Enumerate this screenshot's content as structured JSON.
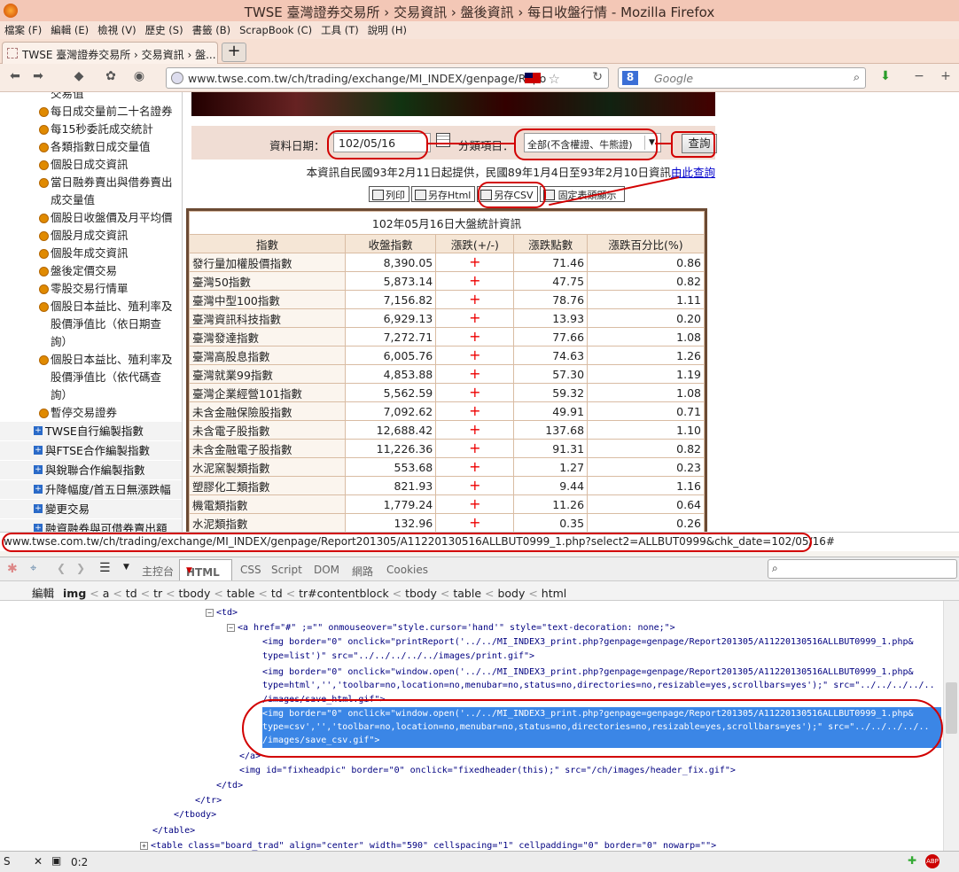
{
  "window": {
    "title": "TWSE 臺灣證券交易所 › 交易資訊 › 盤後資訊 › 每日收盤行情 - Mozilla Firefox"
  },
  "menu": [
    "檔案 (F)",
    "編輯 (E)",
    "檢視 (V)",
    "歷史 (S)",
    "書籤 (B)",
    "ScrapBook (C)",
    "工具 (T)",
    "說明 (H)"
  ],
  "tab": {
    "title": "TWSE 臺灣證券交易所 › 交易資訊 › 盤..."
  },
  "nav": {
    "url": "www.twse.com.tw/ch/trading/exchange/MI_INDEX/genpage/Repo",
    "search_placeholder": "Google",
    "search_engine": "8"
  },
  "sidebar": {
    "sub": [
      "交易值",
      "每日成交量前二十名證券",
      "每15秒委託成交統計",
      "各類指數日成交量值",
      "個股日成交資訊",
      "當日融券賣出與借券賣出",
      "成交量值",
      "個股日收盤價及月平均價",
      "個股月成交資訊",
      "個股年成交資訊",
      "盤後定價交易",
      "零股交易行情單",
      "個股日本益比、殖利率及",
      "股價淨值比（依日期查",
      "詢）",
      "個股日本益比、殖利率及",
      "股價淨值比（依代碼查",
      "詢）",
      "暫停交易證券"
    ],
    "bullets": [
      false,
      true,
      true,
      true,
      true,
      true,
      false,
      true,
      true,
      true,
      true,
      true,
      true,
      false,
      false,
      true,
      false,
      false,
      true
    ],
    "main": [
      "TWSE自行編製指數",
      "與FTSE合作編製指數",
      "與銳聯合作編製指數",
      "升降幅度/首五日無漲跌幅",
      "變更交易",
      "融資融券與可借券賣出額"
    ]
  },
  "query": {
    "date_label": "資料日期：",
    "date_value": "102/05/16",
    "category_label": "分類項目：",
    "category_value": "全部(不含權證、牛熊證)",
    "submit": "查詢",
    "note": "本資訊自民國93年2月11日起提供，民國89年1月4日至93年2月10日資訊",
    "note_link": "由此查詢"
  },
  "toolbar": {
    "print": "列印",
    "save_html": "另存Html",
    "save_csv": "另存CSV",
    "fixed_header": "固定表頭顯示"
  },
  "table": {
    "caption": "102年05月16日大盤統計資訊",
    "headers": [
      "指數",
      "收盤指數",
      "漲跌(+/-)",
      "漲跌點數",
      "漲跌百分比(%)"
    ],
    "rows": [
      [
        "發行量加權股價指數",
        "8,390.05",
        "+",
        "71.46",
        "0.86"
      ],
      [
        "臺灣50指數",
        "5,873.14",
        "+",
        "47.75",
        "0.82"
      ],
      [
        "臺灣中型100指數",
        "7,156.82",
        "+",
        "78.76",
        "1.11"
      ],
      [
        "臺灣資訊科技指數",
        "6,929.13",
        "+",
        "13.93",
        "0.20"
      ],
      [
        "臺灣發達指數",
        "7,272.71",
        "+",
        "77.66",
        "1.08"
      ],
      [
        "臺灣高股息指數",
        "6,005.76",
        "+",
        "74.63",
        "1.26"
      ],
      [
        "臺灣就業99指數",
        "4,853.88",
        "+",
        "57.30",
        "1.19"
      ],
      [
        "臺灣企業經營101指數",
        "5,562.59",
        "+",
        "59.32",
        "1.08"
      ],
      [
        "未含金融保險股指數",
        "7,092.62",
        "+",
        "49.91",
        "0.71"
      ],
      [
        "未含電子股指數",
        "12,688.42",
        "+",
        "137.68",
        "1.10"
      ],
      [
        "未含金融電子股指數",
        "11,226.36",
        "+",
        "91.31",
        "0.82"
      ],
      [
        "水泥窯製類指數",
        "553.68",
        "+",
        "1.27",
        "0.23"
      ],
      [
        "塑膠化工類指數",
        "821.93",
        "+",
        "9.44",
        "1.16"
      ],
      [
        "機電類指數",
        "1,779.24",
        "+",
        "11.26",
        "0.64"
      ],
      [
        "水泥類指數",
        "132.96",
        "+",
        "0.35",
        "0.26"
      ]
    ]
  },
  "status_url": "www.twse.com.tw/ch/trading/exchange/MI_INDEX/genpage/Report201305/A11220130516ALLBUT0999_1.php?select2=ALLBUT0999&chk_date=102/05/16#",
  "firebug": {
    "tabs": [
      "主控台",
      "HTML",
      "CSS",
      "Script",
      "DOM",
      "網路",
      "Cookies"
    ],
    "edit": "編輯",
    "crumbs": [
      "img",
      "a",
      "td",
      "tr",
      "tbody",
      "table",
      "td",
      "tr#contentblock",
      "tbody",
      "table",
      "body",
      "html"
    ]
  },
  "code": [
    "<td>",
    "<a href=\"#\" ;=\"\" onmouseover=\"style.cursor='hand'\" style=\"text-decoration: none;\">",
    "<img border=\"0\" onclick=\"printReport('../../MI_INDEX3_print.php?genpage=genpage/Report201305/A11220130516ALLBUT0999_1.php&",
    "type=list')\" src=\"../../../../../images/print.gif\">",
    "<img border=\"0\" onclick=\"window.open('../../MI_INDEX3_print.php?genpage=genpage/Report201305/A11220130516ALLBUT0999_1.php&",
    "type=html','','toolbar=no,location=no,menubar=no,status=no,directories=no,resizable=yes,scrollbars=yes');\" src=\"../../../../..",
    "/images/save_html.gif\">",
    "<img border=\"0\" onclick=\"window.open('../../MI_INDEX3_print.php?genpage=genpage/Report201305/A11220130516ALLBUT0999_1.php&",
    "type=csv','','toolbar=no,location=no,menubar=no,status=no,directories=no,resizable=yes,scrollbars=yes');\" src=\"../../../../..",
    "/images/save_csv.gif\">",
    "</a>",
    "<img id=\"fixheadpic\" border=\"0\" onclick=\"fixedheader(this);\" src=\"/ch/images/header_fix.gif\">",
    "</td>",
    "</tr>",
    "</tbody>",
    "</table>",
    "<table class=\"board_trad\" align=\"center\" width=\"590\" cellspacing=\"1\" cellpadding=\"0\" border=\"0\" nowarp=\"\">"
  ],
  "bottom": {
    "timer": "0:2"
  },
  "colors": {
    "annotation": "#d20000",
    "highlight": "#3b86e6",
    "table_border": "#6b4a33"
  }
}
